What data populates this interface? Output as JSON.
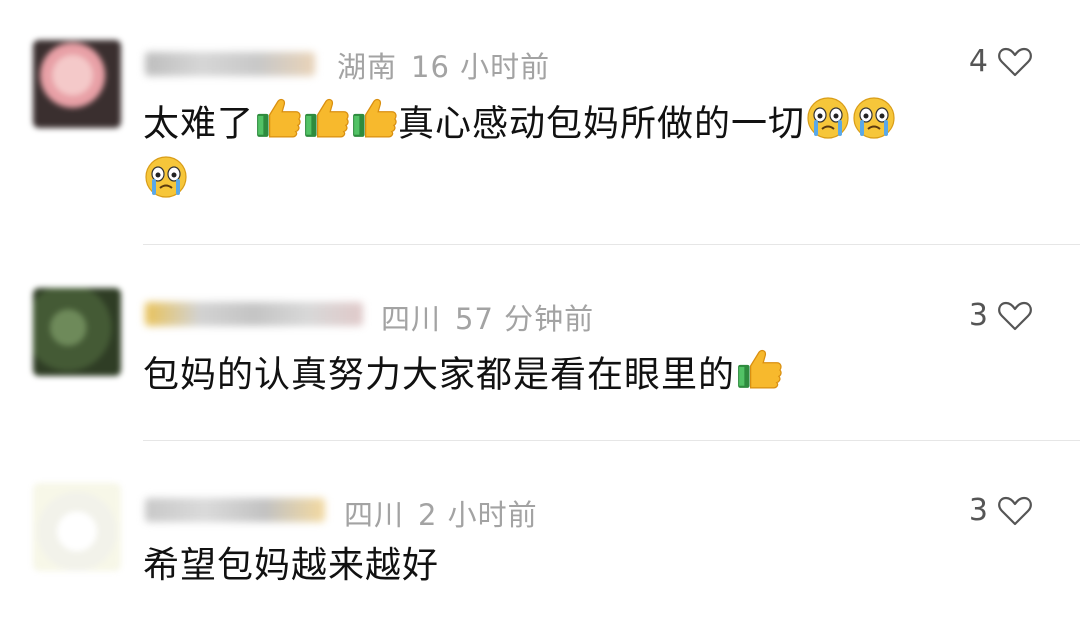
{
  "comments": [
    {
      "location": "湖南",
      "time": "16 小时前",
      "likes": "4",
      "text_a": "太难了",
      "text_b": "真心感动包妈所做的一切"
    },
    {
      "location": "四川",
      "time": "57 分钟前",
      "likes": "3",
      "text_a": "包妈的认真努力大家都是看在眼里的"
    },
    {
      "location": "四川",
      "time": "2 小时前",
      "likes": "3",
      "text_a": "希望包妈越来越好"
    }
  ],
  "icons": {
    "like": "heart-outline-icon",
    "thumbs": "thumbs-up-emoji-icon",
    "crying": "crying-emoji-icon"
  },
  "colors": {
    "meta_text": "#a3a3a3",
    "body_text": "#111111",
    "divider": "#e6e6e6"
  }
}
